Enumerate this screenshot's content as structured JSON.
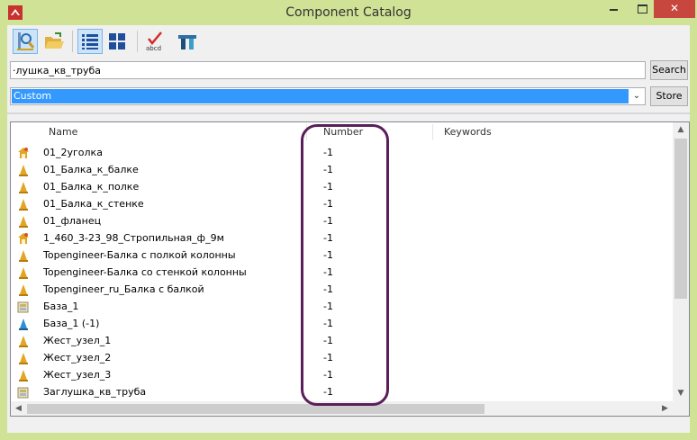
{
  "window": {
    "title": "Component Catalog"
  },
  "toolbar": {
    "buttons": [
      {
        "name": "search-view-icon",
        "active": true
      },
      {
        "name": "open-folder-icon",
        "active": false
      },
      {
        "name": "list-view-icon",
        "active": true
      },
      {
        "name": "thumbnail-view-icon",
        "active": false
      },
      {
        "name": "check-abcd-icon",
        "active": false,
        "caption": "abcd"
      },
      {
        "name": "beam-tool-icon",
        "active": false
      }
    ]
  },
  "search": {
    "value": "заглушка_кв_труба",
    "display_value": "·лушка_кв_труба",
    "button_label": "Search"
  },
  "group": {
    "selected": "Custom",
    "store_label": "Store"
  },
  "table": {
    "columns": [
      "Name",
      "Number",
      "Keywords"
    ],
    "rows": [
      {
        "icon": "component-cluster-icon",
        "name": "01_2уголка",
        "number": "-1"
      },
      {
        "icon": "component-cone-icon",
        "name": "01_Балка_к_балке",
        "number": "-1"
      },
      {
        "icon": "component-cone-icon",
        "name": "01_Балка_к_полке",
        "number": "-1"
      },
      {
        "icon": "component-cone-icon",
        "name": "01_Балка_к_стенке",
        "number": "-1"
      },
      {
        "icon": "component-cone-icon",
        "name": "01_фланец",
        "number": "-1"
      },
      {
        "icon": "component-cluster-icon",
        "name": "1_460_3-23_98_Стропильная_ф_9м",
        "number": "-1"
      },
      {
        "icon": "component-cone-icon",
        "name": "Topengineer-Балка с полкой колонны",
        "number": "-1"
      },
      {
        "icon": "component-cone-icon",
        "name": "Topengineer-Балка со стенкой колонны",
        "number": "-1"
      },
      {
        "icon": "component-cone-icon",
        "name": "Topengineer_ru_Балка с балкой",
        "number": "-1"
      },
      {
        "icon": "component-part-icon",
        "name": "База_1",
        "number": "-1"
      },
      {
        "icon": "component-blue-cone-icon",
        "name": "База_1 (-1)",
        "number": "-1"
      },
      {
        "icon": "component-cone-icon",
        "name": "Жест_узел_1",
        "number": "-1"
      },
      {
        "icon": "component-cone-icon",
        "name": "Жест_узел_2",
        "number": "-1"
      },
      {
        "icon": "component-cone-icon",
        "name": "Жест_узел_3",
        "number": "-1"
      },
      {
        "icon": "component-part-icon",
        "name": "Заглушка_кв_труба",
        "number": "-1"
      }
    ]
  },
  "colors": {
    "frame": "#cfe295",
    "selection": "#3399ff",
    "highlight_ring": "#5a1f5a",
    "close_button": "#c7463d"
  }
}
